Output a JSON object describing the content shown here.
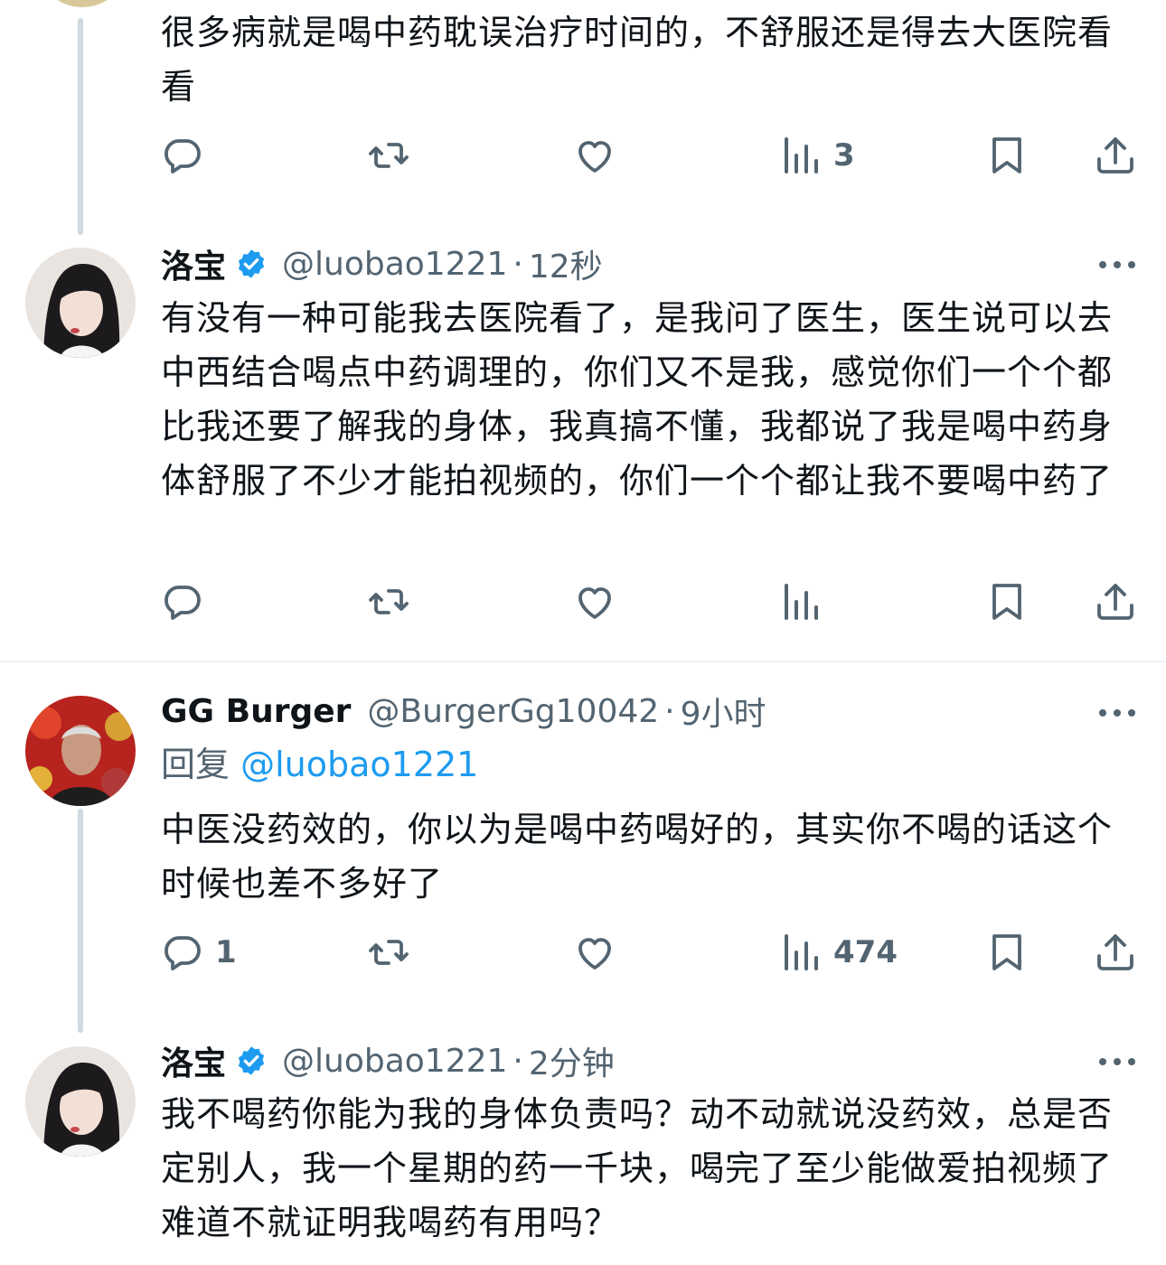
{
  "colors": {
    "text": "#0f1419",
    "secondary": "#536471",
    "accent": "#1d9bf0",
    "divider": "#eff3f4",
    "thread_line": "#cfd9de"
  },
  "tweets": [
    {
      "text": "很多病就是喝中药耽误治疗时间的，不舒服还是得去大医院看看",
      "actions": {
        "reply_count": "",
        "retweet_count": "",
        "like_count": "",
        "views_count": "3"
      }
    },
    {
      "name": "洛宝",
      "verified": true,
      "handle": "@luobao1221",
      "separator": "·",
      "time": "12秒",
      "text": "有没有一种可能我去医院看了，是我问了医生，医生说可以去中西结合喝点中药调理的，你们又不是我，感觉你们一个个都比我还要了解我的身体，我真搞不懂，我都说了我是喝中药身体舒服了不少才能拍视频的，你们一个个都让我不要喝中药了",
      "actions": {
        "reply_count": "",
        "retweet_count": "",
        "like_count": "",
        "views_count": ""
      }
    },
    {
      "name": "GG Burger",
      "verified": false,
      "handle": "@BurgerGg10042",
      "separator": "·",
      "time": "9小时",
      "reply_label": "回复",
      "reply_to": "@luobao1221",
      "text": "中医没药效的，你以为是喝中药喝好的，其实你不喝的话这个时候也差不多好了",
      "actions": {
        "reply_count": "1",
        "retweet_count": "",
        "like_count": "",
        "views_count": "474"
      }
    },
    {
      "name": "洛宝",
      "verified": true,
      "handle": "@luobao1221",
      "separator": "·",
      "time": "2分钟",
      "text": "我不喝药你能为我的身体负责吗？动不动就说没药效，总是否定别人，我一个星期的药一千块，喝完了至少能做爱拍视频了难道不就证明我喝药有用吗？",
      "actions": {
        "reply_count": "",
        "retweet_count": "",
        "like_count": "",
        "views_count": ""
      }
    }
  ]
}
